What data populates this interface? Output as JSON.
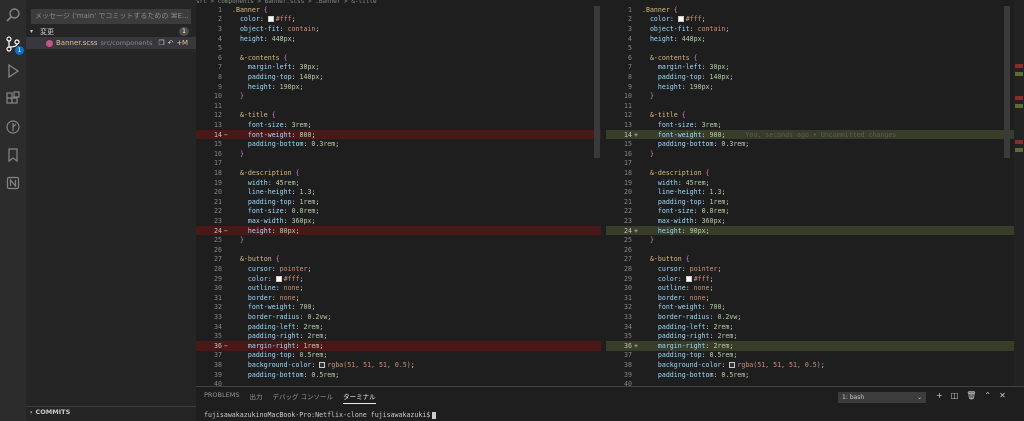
{
  "activity_bar": {
    "icons": [
      "search-icon",
      "source-control-icon",
      "run-debug-icon",
      "extensions-icon",
      "git-graph-icon",
      "bookmark-icon",
      "notion-icon"
    ],
    "scm_badge": "1"
  },
  "sidebar": {
    "commit_placeholder": "メッセージ ('main' でコミットするための ⌘E...",
    "changes_label": "変更",
    "changes_count": "1",
    "file": {
      "name": "Banner.scss",
      "path": "src/components",
      "status": "M"
    },
    "commits_label": "COMMITS"
  },
  "editor_left": {
    "breadcrumb": "src > components > Banner.scss > .Banner > &-title",
    "lines": [
      {
        "n": "1",
        "t": "normal",
        "html": "<span class=\"sel\">.Banner</span> <span class=\"brace\">{</span>"
      },
      {
        "n": "2",
        "t": "normal",
        "html": "  <span class=\"prop\">color</span><span class=\"punc\">: </span><span class=\"swatch\" style=\"background:#fff\"></span><span class=\"val\">#fff</span><span class=\"punc\">;</span>"
      },
      {
        "n": "3",
        "t": "normal",
        "html": "  <span class=\"prop\">object-fit</span><span class=\"punc\">: </span><span class=\"val\">contain</span><span class=\"punc\">;</span>"
      },
      {
        "n": "4",
        "t": "normal",
        "html": "  <span class=\"prop\">height</span><span class=\"punc\">: </span><span class=\"num\">448px</span><span class=\"punc\">;</span>"
      },
      {
        "n": "5",
        "t": "normal",
        "html": ""
      },
      {
        "n": "6",
        "t": "normal",
        "html": "  <span class=\"sel\">&amp;-contents</span> <span class=\"brace\">{</span>"
      },
      {
        "n": "7",
        "t": "normal",
        "html": "    <span class=\"prop\">margin-left</span><span class=\"punc\">: </span><span class=\"num\">30px</span><span class=\"punc\">;</span>"
      },
      {
        "n": "8",
        "t": "normal",
        "html": "    <span class=\"prop\">padding-top</span><span class=\"punc\">: </span><span class=\"num\">140px</span><span class=\"punc\">;</span>"
      },
      {
        "n": "9",
        "t": "normal",
        "html": "    <span class=\"prop\">height</span><span class=\"punc\">: </span><span class=\"num\">190px</span><span class=\"punc\">;</span>"
      },
      {
        "n": "10",
        "t": "normal",
        "html": "  <span class=\"brace\">}</span>"
      },
      {
        "n": "11",
        "t": "normal",
        "html": ""
      },
      {
        "n": "12",
        "t": "normal",
        "html": "  <span class=\"sel\">&amp;-title</span> <span class=\"brace\">{</span>"
      },
      {
        "n": "13",
        "t": "normal",
        "html": "    <span class=\"prop\">font-size</span><span class=\"punc\">: </span><span class=\"num\">3rem</span><span class=\"punc\">;</span>"
      },
      {
        "n": "14",
        "t": "del",
        "html": "    <span class=\"prop\">font-weight</span><span class=\"punc\">: </span><span class=\"num\">800</span><span class=\"punc\">;</span>"
      },
      {
        "n": "15",
        "t": "normal",
        "html": "    <span class=\"prop\">padding-bottom</span><span class=\"punc\">: </span><span class=\"num\">0.3rem</span><span class=\"punc\">;</span>"
      },
      {
        "n": "16",
        "t": "normal",
        "html": "  <span class=\"brace\">}</span>"
      },
      {
        "n": "17",
        "t": "normal",
        "html": ""
      },
      {
        "n": "18",
        "t": "normal",
        "html": "  <span class=\"sel\">&amp;-description</span> <span class=\"brace\">{</span>"
      },
      {
        "n": "19",
        "t": "normal",
        "html": "    <span class=\"prop\">width</span><span class=\"punc\">: </span><span class=\"num\">45rem</span><span class=\"punc\">;</span>"
      },
      {
        "n": "20",
        "t": "normal",
        "html": "    <span class=\"prop\">line-height</span><span class=\"punc\">: </span><span class=\"num\">1.3</span><span class=\"punc\">;</span>"
      },
      {
        "n": "21",
        "t": "normal",
        "html": "    <span class=\"prop\">padding-top</span><span class=\"punc\">: </span><span class=\"num\">1rem</span><span class=\"punc\">;</span>"
      },
      {
        "n": "22",
        "t": "normal",
        "html": "    <span class=\"prop\">font-size</span><span class=\"punc\">: </span><span class=\"num\">0.8rem</span><span class=\"punc\">;</span>"
      },
      {
        "n": "23",
        "t": "normal",
        "html": "    <span class=\"prop\">max-width</span><span class=\"punc\">: </span><span class=\"num\">360px</span><span class=\"punc\">;</span>"
      },
      {
        "n": "24",
        "t": "del",
        "html": "    <span class=\"prop\">height</span><span class=\"punc\">: </span><span class=\"num\">80px</span><span class=\"punc\">;</span>"
      },
      {
        "n": "25",
        "t": "normal",
        "html": "  <span class=\"brace\">}</span>"
      },
      {
        "n": "26",
        "t": "normal",
        "html": ""
      },
      {
        "n": "27",
        "t": "normal",
        "html": "  <span class=\"sel\">&amp;-button</span> <span class=\"brace\">{</span>"
      },
      {
        "n": "28",
        "t": "normal",
        "html": "    <span class=\"prop\">cursor</span><span class=\"punc\">: </span><span class=\"val\">pointer</span><span class=\"punc\">;</span>"
      },
      {
        "n": "29",
        "t": "normal",
        "html": "    <span class=\"prop\">color</span><span class=\"punc\">: </span><span class=\"swatch\" style=\"background:#fff\"></span><span class=\"val\">#fff</span><span class=\"punc\">;</span>"
      },
      {
        "n": "30",
        "t": "normal",
        "html": "    <span class=\"prop\">outline</span><span class=\"punc\">: </span><span class=\"val\">none</span><span class=\"punc\">;</span>"
      },
      {
        "n": "31",
        "t": "normal",
        "html": "    <span class=\"prop\">border</span><span class=\"punc\">: </span><span class=\"val\">none</span><span class=\"punc\">;</span>"
      },
      {
        "n": "32",
        "t": "normal",
        "html": "    <span class=\"prop\">font-weight</span><span class=\"punc\">: </span><span class=\"num\">700</span><span class=\"punc\">;</span>"
      },
      {
        "n": "33",
        "t": "normal",
        "html": "    <span class=\"prop\">border-radius</span><span class=\"punc\">: </span><span class=\"num\">0.2vw</span><span class=\"punc\">;</span>"
      },
      {
        "n": "34",
        "t": "normal",
        "html": "    <span class=\"prop\">padding-left</span><span class=\"punc\">: </span><span class=\"num\">2rem</span><span class=\"punc\">;</span>"
      },
      {
        "n": "35",
        "t": "normal",
        "html": "    <span class=\"prop\">padding-right</span><span class=\"punc\">: </span><span class=\"num\">2rem</span><span class=\"punc\">;</span>"
      },
      {
        "n": "36",
        "t": "del",
        "html": "    <span class=\"prop\">margin-right</span><span class=\"punc\">: </span><span class=\"num\">1rem</span><span class=\"punc\">;</span>"
      },
      {
        "n": "37",
        "t": "normal",
        "html": "    <span class=\"prop\">padding-top</span><span class=\"punc\">: </span><span class=\"num\">0.5rem</span><span class=\"punc\">;</span>"
      },
      {
        "n": "38",
        "t": "normal",
        "html": "    <span class=\"prop\">background-color</span><span class=\"punc\">: </span><span class=\"swatch\" style=\"background:#333\"></span><span class=\"val\">rgba(51, 51, 51, 0.5)</span><span class=\"punc\">;</span>"
      },
      {
        "n": "39",
        "t": "normal",
        "html": "    <span class=\"prop\">padding-bottom</span><span class=\"punc\">: </span><span class=\"num\">0.5rem</span><span class=\"punc\">;</span>"
      },
      {
        "n": "40",
        "t": "normal",
        "html": ""
      }
    ]
  },
  "editor_right": {
    "blame": "You, seconds ago • Uncommitted changes",
    "lines": [
      {
        "n": "1",
        "t": "normal",
        "html": "<span class=\"sel\">.Banner</span> <span class=\"brace\">{</span>"
      },
      {
        "n": "2",
        "t": "normal",
        "html": "  <span class=\"prop\">color</span><span class=\"punc\">: </span><span class=\"swatch\" style=\"background:#fff\"></span><span class=\"val\">#fff</span><span class=\"punc\">;</span>"
      },
      {
        "n": "3",
        "t": "normal",
        "html": "  <span class=\"prop\">object-fit</span><span class=\"punc\">: </span><span class=\"val\">contain</span><span class=\"punc\">;</span>"
      },
      {
        "n": "4",
        "t": "normal",
        "html": "  <span class=\"prop\">height</span><span class=\"punc\">: </span><span class=\"num\">448px</span><span class=\"punc\">;</span>"
      },
      {
        "n": "5",
        "t": "normal",
        "html": ""
      },
      {
        "n": "6",
        "t": "normal",
        "html": "  <span class=\"sel\">&amp;-contents</span> <span class=\"brace\">{</span>"
      },
      {
        "n": "7",
        "t": "normal",
        "html": "    <span class=\"prop\">margin-left</span><span class=\"punc\">: </span><span class=\"num\">30px</span><span class=\"punc\">;</span>"
      },
      {
        "n": "8",
        "t": "normal",
        "html": "    <span class=\"prop\">padding-top</span><span class=\"punc\">: </span><span class=\"num\">140px</span><span class=\"punc\">;</span>"
      },
      {
        "n": "9",
        "t": "normal",
        "html": "    <span class=\"prop\">height</span><span class=\"punc\">: </span><span class=\"num\">190px</span><span class=\"punc\">;</span>"
      },
      {
        "n": "10",
        "t": "normal",
        "html": "  <span class=\"brace\">}</span>"
      },
      {
        "n": "11",
        "t": "normal",
        "html": ""
      },
      {
        "n": "12",
        "t": "normal",
        "html": "  <span class=\"sel\">&amp;-title</span> <span class=\"brace\">{</span>"
      },
      {
        "n": "13",
        "t": "normal",
        "html": "    <span class=\"prop\">font-size</span><span class=\"punc\">: </span><span class=\"num\">3rem</span><span class=\"punc\">;</span>"
      },
      {
        "n": "14",
        "t": "add",
        "blame": true,
        "html": "    <span class=\"prop\">font-weight</span><span class=\"punc\">: </span><span class=\"num\">900</span><span class=\"punc\">;</span>"
      },
      {
        "n": "15",
        "t": "normal",
        "html": "    <span class=\"prop\">padding-bottom</span><span class=\"punc\">: </span><span class=\"num\">0.3rem</span><span class=\"punc\">;</span>"
      },
      {
        "n": "16",
        "t": "normal",
        "html": "  <span class=\"brace\">}</span>"
      },
      {
        "n": "17",
        "t": "normal",
        "html": ""
      },
      {
        "n": "18",
        "t": "normal",
        "html": "  <span class=\"sel\">&amp;-description</span> <span class=\"brace\">{</span>"
      },
      {
        "n": "19",
        "t": "normal",
        "html": "    <span class=\"prop\">width</span><span class=\"punc\">: </span><span class=\"num\">45rem</span><span class=\"punc\">;</span>"
      },
      {
        "n": "20",
        "t": "normal",
        "html": "    <span class=\"prop\">line-height</span><span class=\"punc\">: </span><span class=\"num\">1.3</span><span class=\"punc\">;</span>"
      },
      {
        "n": "21",
        "t": "normal",
        "html": "    <span class=\"prop\">padding-top</span><span class=\"punc\">: </span><span class=\"num\">1rem</span><span class=\"punc\">;</span>"
      },
      {
        "n": "22",
        "t": "normal",
        "html": "    <span class=\"prop\">font-size</span><span class=\"punc\">: </span><span class=\"num\">0.8rem</span><span class=\"punc\">;</span>"
      },
      {
        "n": "23",
        "t": "normal",
        "html": "    <span class=\"prop\">max-width</span><span class=\"punc\">: </span><span class=\"num\">360px</span><span class=\"punc\">;</span>"
      },
      {
        "n": "24",
        "t": "add",
        "html": "    <span class=\"prop\">height</span><span class=\"punc\">: </span><span class=\"num\">90px</span><span class=\"punc\">;</span>"
      },
      {
        "n": "25",
        "t": "normal",
        "html": "  <span class=\"brace\">}</span>"
      },
      {
        "n": "26",
        "t": "normal",
        "html": ""
      },
      {
        "n": "27",
        "t": "normal",
        "html": "  <span class=\"sel\">&amp;-button</span> <span class=\"brace\">{</span>"
      },
      {
        "n": "28",
        "t": "normal",
        "html": "    <span class=\"prop\">cursor</span><span class=\"punc\">: </span><span class=\"val\">pointer</span><span class=\"punc\">;</span>"
      },
      {
        "n": "29",
        "t": "normal",
        "html": "    <span class=\"prop\">color</span><span class=\"punc\">: </span><span class=\"swatch\" style=\"background:#fff\"></span><span class=\"val\">#fff</span><span class=\"punc\">;</span>"
      },
      {
        "n": "30",
        "t": "normal",
        "html": "    <span class=\"prop\">outline</span><span class=\"punc\">: </span><span class=\"val\">none</span><span class=\"punc\">;</span>"
      },
      {
        "n": "31",
        "t": "normal",
        "html": "    <span class=\"prop\">border</span><span class=\"punc\">: </span><span class=\"val\">none</span><span class=\"punc\">;</span>"
      },
      {
        "n": "32",
        "t": "normal",
        "html": "    <span class=\"prop\">font-weight</span><span class=\"punc\">: </span><span class=\"num\">700</span><span class=\"punc\">;</span>"
      },
      {
        "n": "33",
        "t": "normal",
        "html": "    <span class=\"prop\">border-radius</span><span class=\"punc\">: </span><span class=\"num\">0.2vw</span><span class=\"punc\">;</span>"
      },
      {
        "n": "34",
        "t": "normal",
        "html": "    <span class=\"prop\">padding-left</span><span class=\"punc\">: </span><span class=\"num\">2rem</span><span class=\"punc\">;</span>"
      },
      {
        "n": "35",
        "t": "normal",
        "html": "    <span class=\"prop\">padding-right</span><span class=\"punc\">: </span><span class=\"num\">2rem</span><span class=\"punc\">;</span>"
      },
      {
        "n": "36",
        "t": "add",
        "html": "    <span class=\"prop\">margin-right</span><span class=\"punc\">: </span><span class=\"num\">2rem</span><span class=\"punc\">;</span>"
      },
      {
        "n": "37",
        "t": "normal",
        "html": "    <span class=\"prop\">padding-top</span><span class=\"punc\">: </span><span class=\"num\">0.5rem</span><span class=\"punc\">;</span>"
      },
      {
        "n": "38",
        "t": "normal",
        "html": "    <span class=\"prop\">background-color</span><span class=\"punc\">: </span><span class=\"swatch\" style=\"background:#333\"></span><span class=\"val\">rgba(51, 51, 51, 0.5)</span><span class=\"punc\">;</span>"
      },
      {
        "n": "39",
        "t": "normal",
        "html": "    <span class=\"prop\">padding-bottom</span><span class=\"punc\">: </span><span class=\"num\">0.5rem</span><span class=\"punc\">;</span>"
      },
      {
        "n": "40",
        "t": "normal",
        "html": ""
      }
    ]
  },
  "panel": {
    "tabs": [
      "PROBLEMS",
      "出力",
      "デバッグ コンソール",
      "ターミナル"
    ],
    "active_tab": 3,
    "terminal_select": "1: bash",
    "prompt": "fujisawakazukinoMacBook-Pro:Netflix-clone fujisawakazuki$"
  }
}
